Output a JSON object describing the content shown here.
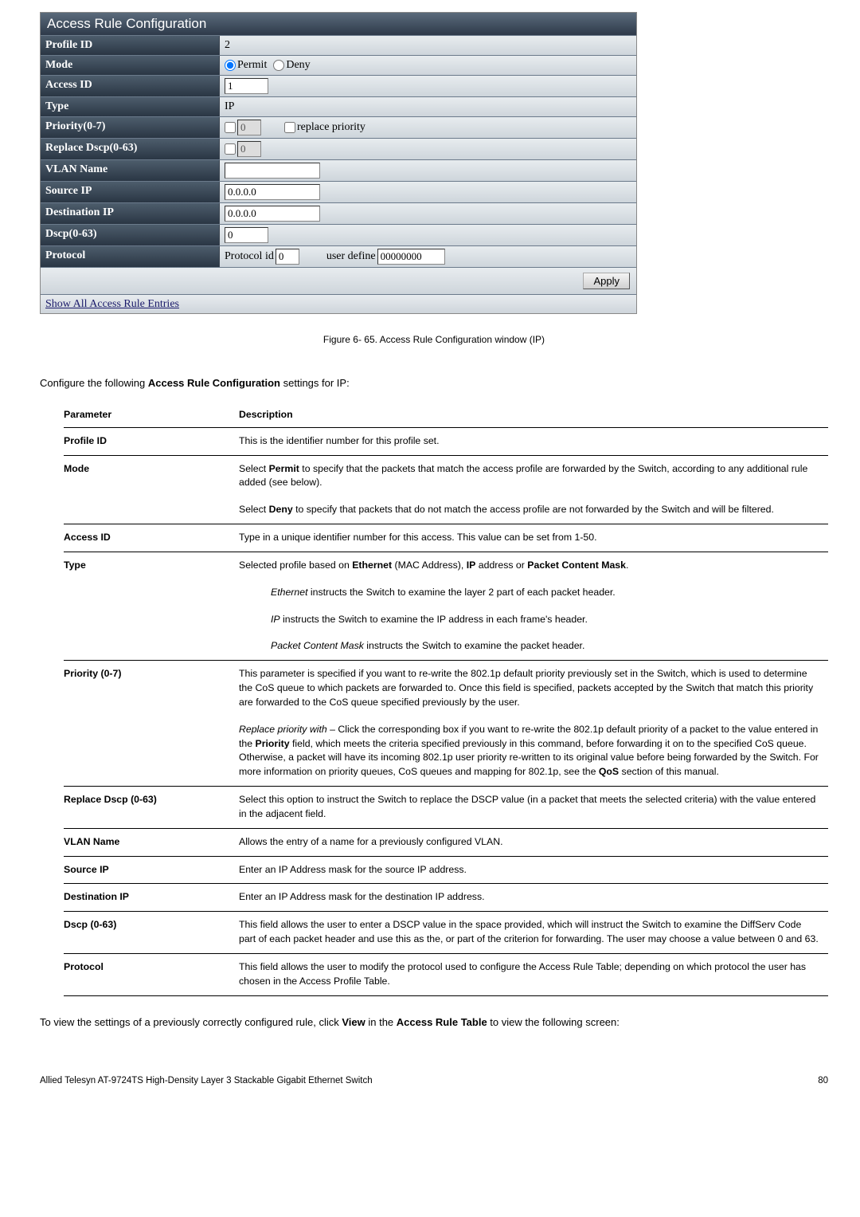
{
  "panel": {
    "header": "Access Rule Configuration",
    "rows": {
      "profile_id": {
        "label": "Profile ID",
        "value": "2"
      },
      "mode": {
        "label": "Mode",
        "permit": "Permit",
        "deny": "Deny"
      },
      "access_id": {
        "label": "Access ID",
        "value": "1"
      },
      "type": {
        "label": "Type",
        "value": "IP"
      },
      "priority": {
        "label": "Priority(0-7)",
        "input": "0",
        "cb_label": "replace priority"
      },
      "replace_dscp": {
        "label": "Replace Dscp(0-63)",
        "input": "0"
      },
      "vlan_name": {
        "label": "VLAN Name",
        "value": ""
      },
      "source_ip": {
        "label": "Source IP",
        "value": "0.0.0.0"
      },
      "dest_ip": {
        "label": "Destination IP",
        "value": "0.0.0.0"
      },
      "dscp": {
        "label": "Dscp(0-63)",
        "value": "0"
      },
      "protocol": {
        "label": "Protocol",
        "proto_label": "Protocol id",
        "proto_val": "0",
        "ud_label": "user define",
        "ud_val": "00000000"
      }
    },
    "apply": "Apply",
    "link": "Show All Access Rule Entries"
  },
  "caption": "Figure 6- 65. Access Rule Configuration window (IP)",
  "intro": {
    "pre": "Configure the following ",
    "bold": "Access Rule Configuration",
    "post": " settings for IP:"
  },
  "table": {
    "h1": "Parameter",
    "h2": "Description",
    "profile_id": {
      "label": "Profile ID",
      "desc": "This is the identifier number for this profile set."
    },
    "mode": {
      "label": "Mode",
      "d1a": "Select ",
      "d1b": "Permit",
      "d1c": " to specify that the packets that match the access profile are forwarded by the Switch, according to any additional rule added (see below).",
      "d2a": "Select ",
      "d2b": "Deny",
      "d2c": " to specify that packets that do not match the access profile are not forwarded by the Switch and will be filtered."
    },
    "access_id": {
      "label": "Access ID",
      "desc": "Type in a unique identifier number for this access. This value can be set from 1-50."
    },
    "type": {
      "label": "Type",
      "d1a": "Selected profile based on ",
      "d1b": "Ethernet",
      "d1c": " (MAC Address), ",
      "d1d": "IP",
      "d1e": " address or ",
      "d1f": "Packet Content Mask",
      "d1g": ".",
      "eth_i": "Ethernet",
      "eth_t": " instructs the Switch to examine the layer 2 part of each packet header.",
      "ip_i": "IP",
      "ip_t": " instructs the Switch to examine the IP address in each frame's header.",
      "pc_i": "Packet Content Mask",
      "pc_t": " instructs the Switch to examine the packet header."
    },
    "priority": {
      "label": "Priority (0-7)",
      "p1": "This parameter is specified if you want to re-write the 802.1p default priority previously set in the Switch, which is used to determine the CoS queue to which packets are forwarded to. Once this field is specified, packets accepted by the Switch that match this priority are forwarded to the CoS queue specified previously by the user.",
      "p2a": "Replace priority with",
      "p2b": " – Click the corresponding box if you want to re-write the 802.1p default priority of a packet to the value entered in the ",
      "p2c": "Priority",
      "p2d": " field, which meets the criteria specified previously in this command, before forwarding it on to the specified CoS queue. Otherwise, a packet will have its incoming 802.1p user priority re-written to its original value before being forwarded by the Switch. For more information on priority queues, CoS queues and mapping for 802.1p, see the ",
      "p2e": "QoS",
      "p2f": " section of this manual."
    },
    "replace_dscp": {
      "label": "Replace Dscp (0-63)",
      "desc": "Select this option to instruct the Switch to replace the DSCP value (in a packet that meets the selected criteria) with the value entered in the adjacent field."
    },
    "vlan": {
      "label": "VLAN Name",
      "desc": "Allows the entry of a name for a previously configured VLAN."
    },
    "src": {
      "label": "Source IP",
      "desc": "Enter an IP Address mask for the source IP address."
    },
    "dst": {
      "label": "Destination IP",
      "desc": "Enter an IP Address mask for the destination IP address."
    },
    "dscp": {
      "label": "Dscp (0-63)",
      "desc": "This field allows the user to enter a DSCP value in the space provided, which will instruct the Switch to examine the DiffServ Code part of each packet header and use this as the, or part of the criterion for forwarding. The user may choose a value between 0 and 63."
    },
    "protocol": {
      "label": "Protocol",
      "desc": "This field allows the user to modify the protocol used to configure the Access Rule Table; depending on which protocol the user has chosen in the Access Profile Table."
    }
  },
  "outro": {
    "a": "To view the settings of a previously correctly configured rule, click ",
    "b": "View",
    "c": " in the ",
    "d": "Access Rule Table",
    "e": " to view the following screen:"
  },
  "footer": {
    "left": "Allied Telesyn AT-9724TS High-Density Layer 3 Stackable Gigabit Ethernet Switch",
    "right": "80"
  }
}
